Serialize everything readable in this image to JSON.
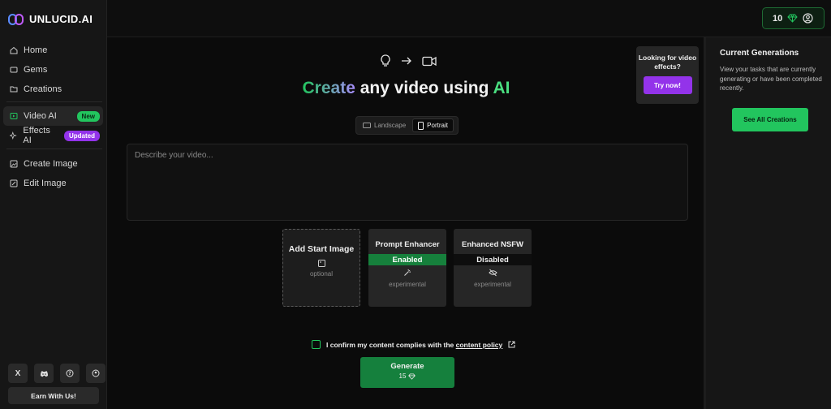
{
  "brand": {
    "name": "UNLUCID.AI"
  },
  "sidebar": {
    "items": [
      {
        "label": "Home",
        "icon": "home-icon"
      },
      {
        "label": "Gems",
        "icon": "gem-icon"
      },
      {
        "label": "Creations",
        "icon": "folder-icon"
      },
      {
        "label": "Video AI",
        "icon": "video-icon",
        "badge": "New",
        "active": true
      },
      {
        "label": "Effects AI",
        "icon": "sparkles-icon",
        "badge": "Updated"
      },
      {
        "label": "Create Image",
        "icon": "image-icon"
      },
      {
        "label": "Edit Image",
        "icon": "edit-image-icon"
      }
    ],
    "social": [
      "X",
      "discord",
      "help",
      "account"
    ],
    "earn_label": "Earn With Us!"
  },
  "topbar": {
    "gems_count": "10"
  },
  "main": {
    "headline": {
      "part1": "Create",
      "part2": " any video using ",
      "part3": "AI"
    },
    "promo": {
      "text": "Looking for video effects?",
      "button": "Try now!"
    },
    "orientation": {
      "landscape": "Landscape",
      "portrait": "Portrait",
      "selected": "Portrait"
    },
    "prompt_placeholder": "Describe your video...",
    "cards": {
      "start_image": {
        "title": "Add Start Image",
        "sub": "optional"
      },
      "prompt_enhancer": {
        "title": "Prompt Enhancer",
        "state": "Enabled",
        "sub": "experimental"
      },
      "nsfw": {
        "title": "Enhanced NSFW",
        "state": "Disabled",
        "sub": "experimental"
      }
    },
    "confirm": {
      "text": "I confirm my content complies with the ",
      "link": "content policy"
    },
    "generate": {
      "label": "Generate",
      "cost": "15"
    }
  },
  "right_panel": {
    "title": "Current Generations",
    "description": "View your tasks that are currently generating or have been completed recently.",
    "button": "See All Creations"
  },
  "colors": {
    "accent_green": "#22c55e",
    "accent_purple": "#9333ea"
  }
}
